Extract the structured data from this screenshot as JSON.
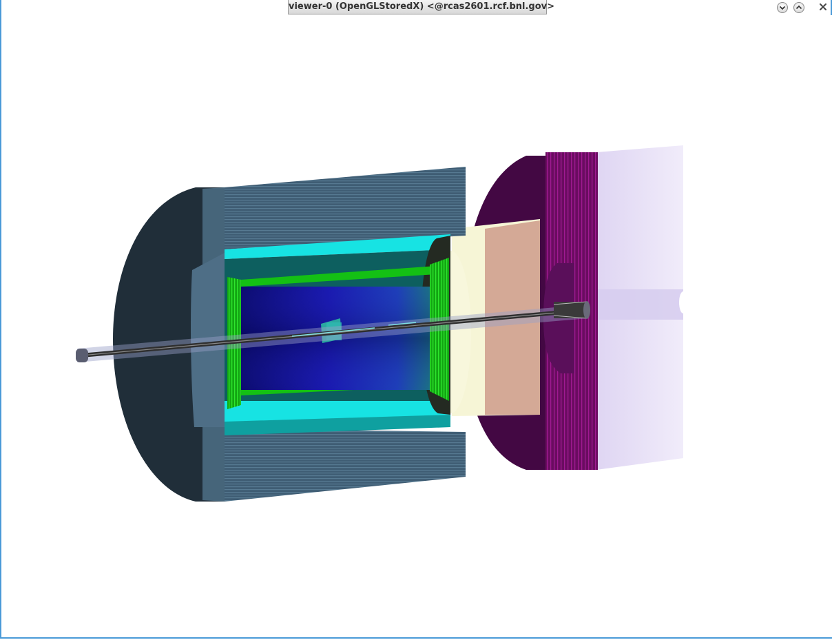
{
  "window": {
    "title": "viewer-0 (OpenGLStoredX) <@rcas2601.rcf.bnl.gov>"
  },
  "controls": {
    "minimize_icon": "chevron-down-icon",
    "maximize_icon": "chevron-up-icon",
    "close_icon": "close-icon"
  },
  "colors": {
    "frame": "#4a9ad8",
    "background": "#ffffff",
    "outer_calorimeter": "#3e5568",
    "solenoid": "#16e4e4",
    "inner_calorimeter": "#18b818",
    "tracker_volume": "#1c1c9c",
    "forward_ring": "#f6f5d6",
    "forward_calorimeter": "#80106e",
    "hadron_endcap": "#e5ddf5",
    "beampipe": "#3a3a3a"
  }
}
